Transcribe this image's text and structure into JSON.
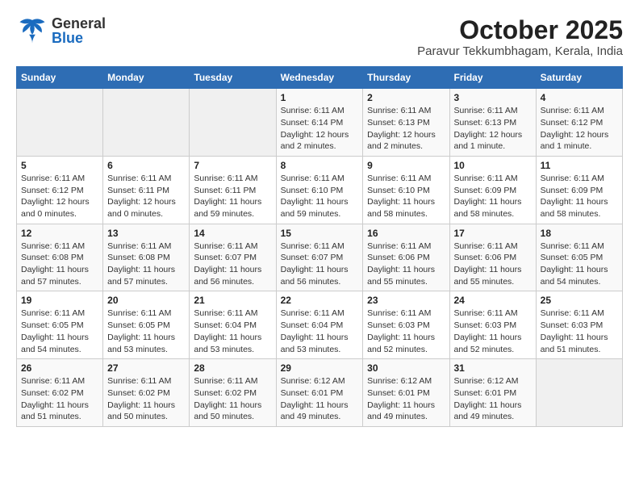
{
  "header": {
    "logo_general": "General",
    "logo_blue": "Blue",
    "month_year": "October 2025",
    "location": "Paravur Tekkumbhagam, Kerala, India"
  },
  "days_of_week": [
    "Sunday",
    "Monday",
    "Tuesday",
    "Wednesday",
    "Thursday",
    "Friday",
    "Saturday"
  ],
  "weeks": [
    [
      {
        "day": "",
        "info": ""
      },
      {
        "day": "",
        "info": ""
      },
      {
        "day": "",
        "info": ""
      },
      {
        "day": "1",
        "info": "Sunrise: 6:11 AM\nSunset: 6:14 PM\nDaylight: 12 hours and 2 minutes."
      },
      {
        "day": "2",
        "info": "Sunrise: 6:11 AM\nSunset: 6:13 PM\nDaylight: 12 hours and 2 minutes."
      },
      {
        "day": "3",
        "info": "Sunrise: 6:11 AM\nSunset: 6:13 PM\nDaylight: 12 hours and 1 minute."
      },
      {
        "day": "4",
        "info": "Sunrise: 6:11 AM\nSunset: 6:12 PM\nDaylight: 12 hours and 1 minute."
      }
    ],
    [
      {
        "day": "5",
        "info": "Sunrise: 6:11 AM\nSunset: 6:12 PM\nDaylight: 12 hours and 0 minutes."
      },
      {
        "day": "6",
        "info": "Sunrise: 6:11 AM\nSunset: 6:11 PM\nDaylight: 12 hours and 0 minutes."
      },
      {
        "day": "7",
        "info": "Sunrise: 6:11 AM\nSunset: 6:11 PM\nDaylight: 11 hours and 59 minutes."
      },
      {
        "day": "8",
        "info": "Sunrise: 6:11 AM\nSunset: 6:10 PM\nDaylight: 11 hours and 59 minutes."
      },
      {
        "day": "9",
        "info": "Sunrise: 6:11 AM\nSunset: 6:10 PM\nDaylight: 11 hours and 58 minutes."
      },
      {
        "day": "10",
        "info": "Sunrise: 6:11 AM\nSunset: 6:09 PM\nDaylight: 11 hours and 58 minutes."
      },
      {
        "day": "11",
        "info": "Sunrise: 6:11 AM\nSunset: 6:09 PM\nDaylight: 11 hours and 58 minutes."
      }
    ],
    [
      {
        "day": "12",
        "info": "Sunrise: 6:11 AM\nSunset: 6:08 PM\nDaylight: 11 hours and 57 minutes."
      },
      {
        "day": "13",
        "info": "Sunrise: 6:11 AM\nSunset: 6:08 PM\nDaylight: 11 hours and 57 minutes."
      },
      {
        "day": "14",
        "info": "Sunrise: 6:11 AM\nSunset: 6:07 PM\nDaylight: 11 hours and 56 minutes."
      },
      {
        "day": "15",
        "info": "Sunrise: 6:11 AM\nSunset: 6:07 PM\nDaylight: 11 hours and 56 minutes."
      },
      {
        "day": "16",
        "info": "Sunrise: 6:11 AM\nSunset: 6:06 PM\nDaylight: 11 hours and 55 minutes."
      },
      {
        "day": "17",
        "info": "Sunrise: 6:11 AM\nSunset: 6:06 PM\nDaylight: 11 hours and 55 minutes."
      },
      {
        "day": "18",
        "info": "Sunrise: 6:11 AM\nSunset: 6:05 PM\nDaylight: 11 hours and 54 minutes."
      }
    ],
    [
      {
        "day": "19",
        "info": "Sunrise: 6:11 AM\nSunset: 6:05 PM\nDaylight: 11 hours and 54 minutes."
      },
      {
        "day": "20",
        "info": "Sunrise: 6:11 AM\nSunset: 6:05 PM\nDaylight: 11 hours and 53 minutes."
      },
      {
        "day": "21",
        "info": "Sunrise: 6:11 AM\nSunset: 6:04 PM\nDaylight: 11 hours and 53 minutes."
      },
      {
        "day": "22",
        "info": "Sunrise: 6:11 AM\nSunset: 6:04 PM\nDaylight: 11 hours and 53 minutes."
      },
      {
        "day": "23",
        "info": "Sunrise: 6:11 AM\nSunset: 6:03 PM\nDaylight: 11 hours and 52 minutes."
      },
      {
        "day": "24",
        "info": "Sunrise: 6:11 AM\nSunset: 6:03 PM\nDaylight: 11 hours and 52 minutes."
      },
      {
        "day": "25",
        "info": "Sunrise: 6:11 AM\nSunset: 6:03 PM\nDaylight: 11 hours and 51 minutes."
      }
    ],
    [
      {
        "day": "26",
        "info": "Sunrise: 6:11 AM\nSunset: 6:02 PM\nDaylight: 11 hours and 51 minutes."
      },
      {
        "day": "27",
        "info": "Sunrise: 6:11 AM\nSunset: 6:02 PM\nDaylight: 11 hours and 50 minutes."
      },
      {
        "day": "28",
        "info": "Sunrise: 6:11 AM\nSunset: 6:02 PM\nDaylight: 11 hours and 50 minutes."
      },
      {
        "day": "29",
        "info": "Sunrise: 6:12 AM\nSunset: 6:01 PM\nDaylight: 11 hours and 49 minutes."
      },
      {
        "day": "30",
        "info": "Sunrise: 6:12 AM\nSunset: 6:01 PM\nDaylight: 11 hours and 49 minutes."
      },
      {
        "day": "31",
        "info": "Sunrise: 6:12 AM\nSunset: 6:01 PM\nDaylight: 11 hours and 49 minutes."
      },
      {
        "day": "",
        "info": ""
      }
    ]
  ]
}
